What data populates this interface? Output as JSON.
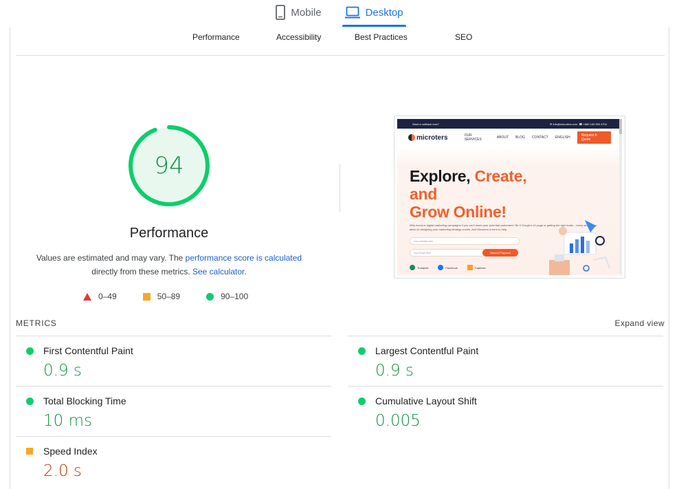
{
  "device_tabs": [
    {
      "label": "Mobile",
      "icon": "phone-icon",
      "active": false
    },
    {
      "label": "Desktop",
      "icon": "laptop-icon",
      "active": true
    }
  ],
  "category_tabs": [
    "Performance",
    "Accessibility",
    "Best Practices",
    "SEO"
  ],
  "gauge": {
    "score": "94",
    "score_value": 94,
    "title": "Performance",
    "desc_prefix": "Values are estimated and may vary. The ",
    "desc_link1": "performance score is calculated",
    "desc_mid": "directly from these metrics. ",
    "desc_link2": "See calculator",
    "desc_suffix": "."
  },
  "legend": [
    {
      "shape": "triangle",
      "range": "0–49",
      "color": "#e53935"
    },
    {
      "shape": "square",
      "range": "50–89",
      "color": "#f9a825"
    },
    {
      "shape": "circle",
      "range": "90–100",
      "color": "#0cce6b"
    }
  ],
  "metrics": {
    "header": "METRICS",
    "expand": "Expand view",
    "items": [
      {
        "label": "First Contentful Paint",
        "value": "0.9 s",
        "status": "pass"
      },
      {
        "label": "Largest Contentful Paint",
        "value": "0.9 s",
        "status": "pass"
      },
      {
        "label": "Total Blocking Time",
        "value": "10 ms",
        "status": "pass"
      },
      {
        "label": "Cumulative Layout Shift",
        "value": "0.005",
        "status": "pass"
      },
      {
        "label": "Speed Index",
        "value": "2.0 s",
        "status": "average"
      }
    ]
  },
  "screenshot": {
    "topbar_left": "Want a callback now?",
    "topbar_email": "info@microters.com",
    "topbar_phone": "+880 163 999 4704",
    "logo": "microters",
    "nav": [
      "OUR SERVICES",
      "ABOUT",
      "BLOG",
      "CONTACT",
      "ENGLISH"
    ],
    "cta": "Request A Quote",
    "headline_1": "Explore,",
    "headline_2": "Create, and",
    "headline_3": "Grow Online!",
    "paragraph": "Why invest in digital marketing campaigns if you can't reach your potential customers? Be it Google's #1 page or getting the right leads – every single step taken to designing your marketing strategy counts. And Microters is here to help.",
    "input1": "Your website here",
    "input2": "Your Email Here",
    "button": "Send A Proposal",
    "badges": [
      "Trustpilot",
      "Facebook",
      "Capterra"
    ]
  },
  "colors": {
    "accent": "#1a73e8",
    "pass": "#0cce6b",
    "pass_text": "#0d8f3f",
    "average": "#f9a825",
    "average_text": "#c33300",
    "fail": "#e53935"
  }
}
